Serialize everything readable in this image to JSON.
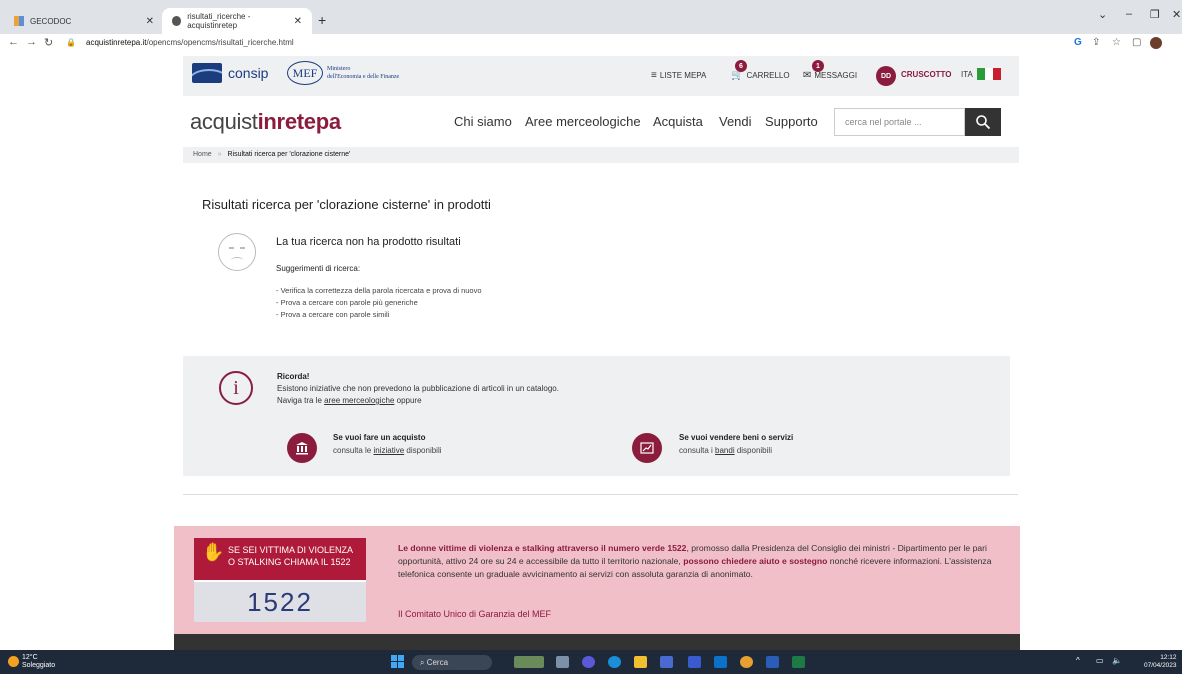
{
  "browser": {
    "tabs": [
      {
        "title": "GECODOC",
        "active": false
      },
      {
        "title": "risultati_ricerche - acquistinretep",
        "active": true
      }
    ],
    "url_host": "acquistinretepa.it",
    "url_path": "/opencms/opencms/risultati_ricerche.html"
  },
  "header": {
    "consip": "consip",
    "mef": "MEF",
    "mef_line1": "Ministero",
    "mef_line2": "dell'Economia e delle Finanze",
    "liste_mepa": "LISTE MEPA",
    "carrello": "CARRELLO",
    "carrello_count": "6",
    "messaggi": "MESSAGGI",
    "messaggi_count": "1",
    "avatar": "DD",
    "cruscotto": "CRUSCOTTO",
    "lang": "ITA"
  },
  "nav": {
    "brand_a": "acquist",
    "brand_b": "inrete",
    "brand_c": "pa",
    "items": [
      "Chi siamo",
      "Aree merceologiche",
      "Acquista",
      "Vendi",
      "Supporto"
    ],
    "search_placeholder": "cerca nel portale ..."
  },
  "breadcrumb": {
    "home": "Home",
    "sep": "»",
    "current": "Risultati ricerca per 'clorazione cisterne'"
  },
  "results": {
    "title": "Risultati ricerca per 'clorazione cisterne' in prodotti",
    "no_results": "La tua ricerca non ha prodotto risultati",
    "suggestions_title": "Suggerimenti di ricerca:",
    "suggestions": [
      "- Verifica la correttezza della parola ricercata e prova di nuovo",
      "- Prova a cercare con parole più generiche",
      "- Prova a cercare con parole simili"
    ]
  },
  "ricorda": {
    "title": "Ricorda!",
    "line1": "Esistono iniziative che non prevedono la pubblicazione di articoli in un catalogo.",
    "line2_pre": "Naviga tra le ",
    "line2_link": "aree merceologiche",
    "line2_post": " oppure",
    "buy_title": "Se vuoi fare un acquisto",
    "buy_pre": "consulta le ",
    "buy_link": "iniziative",
    "buy_post": " disponibili",
    "sell_title": "Se vuoi vendere beni o servizi",
    "sell_pre": "consulta i ",
    "sell_link": "bandi",
    "sell_post": " disponibili"
  },
  "banner": {
    "line1": "SE SEI VITTIMA DI VIOLENZA",
    "line2": "O STALKING CHIAMA IL 1522",
    "number": "1522",
    "text_bold1": "Le donne vittime di violenza e stalking attraverso il numero verde 1522",
    "text1": ", promosso dalla Presidenza del Consiglio dei ministri - Dipartimento per le pari opportunità, attivo 24 ore su 24 e accessibile da tutto il territorio nazionale, ",
    "text_bold2": "possono chiedere aiuto e sostegno",
    "text2": " nonché ricevere informazioni. L'assistenza telefonica consente un graduale avvicinamento ai servizi con assoluta garanzia di anonimato.",
    "link": "Il Comitato Unico di Garanzia del MEF"
  },
  "taskbar": {
    "temp": "12°C",
    "weather": "Soleggiato",
    "search": "Cerca",
    "time": "12:12",
    "date": "07/04/2023"
  },
  "colors": {
    "accent": "#8b1c3d",
    "brand_blue": "#1c3c80",
    "pink": "#f1bfc8"
  }
}
